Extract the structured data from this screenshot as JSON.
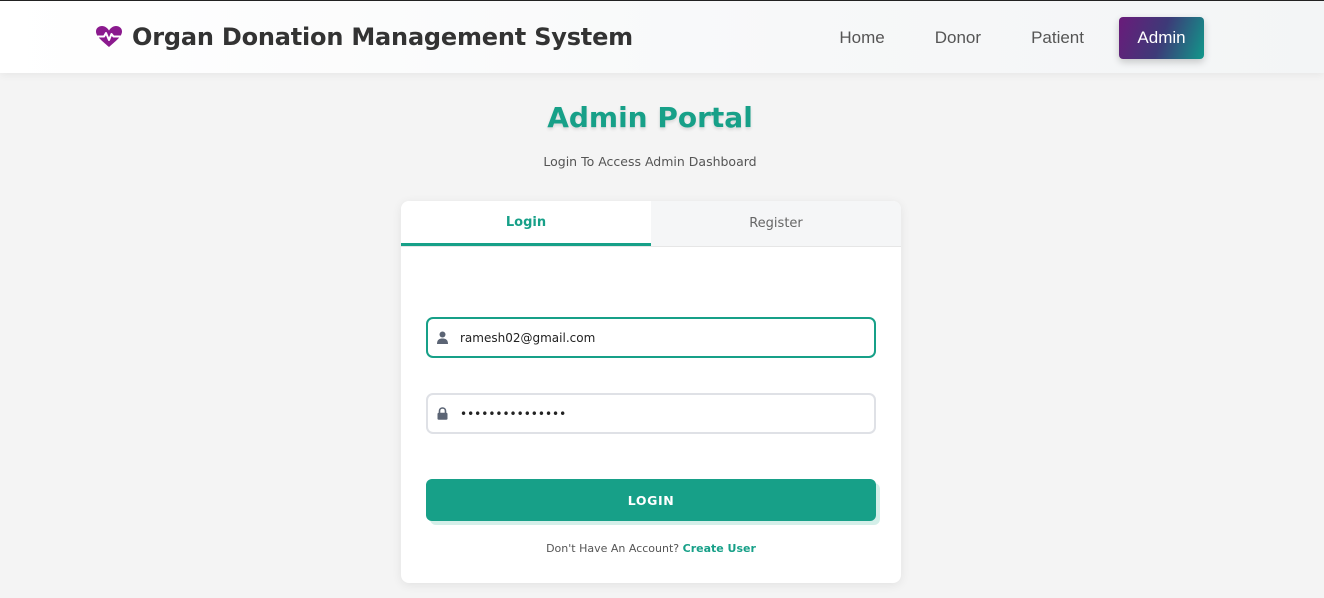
{
  "app": {
    "title": "Organ Donation Management System",
    "brand_color": "#8b1a8e",
    "accent_color": "#17a088"
  },
  "nav": {
    "items": [
      {
        "label": "Home"
      },
      {
        "label": "Donor"
      },
      {
        "label": "Patient"
      },
      {
        "label": "Admin",
        "active": true
      }
    ]
  },
  "header": {
    "title": "Admin Portal",
    "subtitle": "Login To Access Admin Dashboard"
  },
  "tabs": [
    {
      "label": "Login",
      "active": true
    },
    {
      "label": "Register",
      "active": false
    }
  ],
  "form": {
    "email": {
      "value": "ramesh02@gmail.com",
      "icon": "user-icon"
    },
    "password": {
      "value": "•••••••••••••••",
      "icon": "lock-icon"
    },
    "submit_label": "LOGIN"
  },
  "footer": {
    "prompt": "Don't Have An Account?",
    "link": "Create User"
  }
}
